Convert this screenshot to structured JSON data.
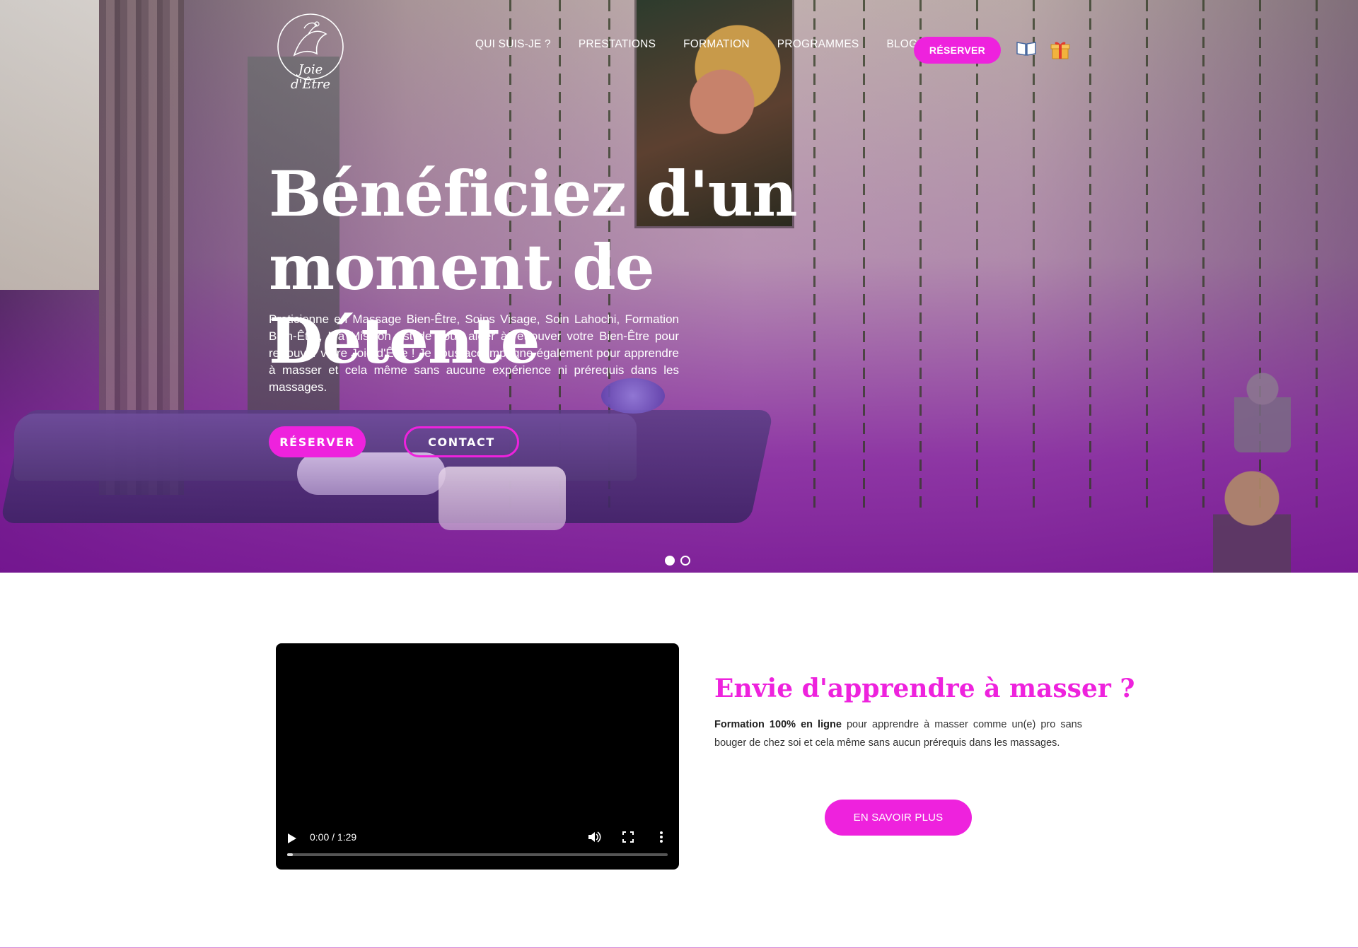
{
  "header": {
    "logo_text": "Joie d'Être",
    "nav": [
      "QUI SUIS-JE ?",
      "PRESTATIONS",
      "FORMATION",
      "PROGRAMMES",
      "BLOG"
    ],
    "reserve_label": "RÉSERVER",
    "icons": [
      "book-icon",
      "gift-icon"
    ]
  },
  "hero": {
    "title_line1": "Bénéficiez d'un",
    "title_line2": "moment de Détente",
    "text": "Praticienne en Massage Bien-Être, Soins Visage, Soin Lahochi, Formation Bien-Être, Ma Mission est de vous aider à retrouver votre Bien-Être pour retrouver votre Joie d'Être ! Je vous accompagne également pour apprendre à masser et cela même sans aucune expérience ni prérequis dans les massages.",
    "btn_reserve": "RÉSERVER",
    "btn_contact": "CONTACT",
    "slides": 2,
    "active_slide": 1
  },
  "video": {
    "time": "0:00 / 1:29",
    "progress": 0.0
  },
  "learn": {
    "title": "Envie d'apprendre à masser ?",
    "text_bold": "Formation 100% en ligne",
    "text_rest": " pour apprendre à masser comme un(e) pro sans bouger de chez soi et cela même sans aucun prérequis dans les massages.",
    "button": "EN SAVOIR PLUS"
  },
  "colors": {
    "accent": "#ee22dd",
    "hero_overlay": "#8a2aa8"
  }
}
